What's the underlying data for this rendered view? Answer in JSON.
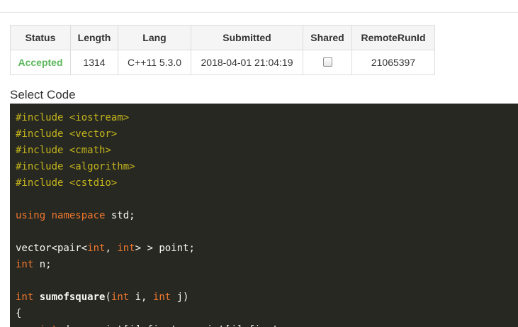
{
  "colors": {
    "accepted": "#5cb85c",
    "code_background": "#272822",
    "preprocessor": "#c4b41b",
    "keyword": "#f0782e",
    "code_text": "#f8f8f2"
  },
  "table": {
    "headers": {
      "status": "Status",
      "length": "Length",
      "lang": "Lang",
      "submitted": "Submitted",
      "shared": "Shared",
      "remote_run_id": "RemoteRunId"
    },
    "row": {
      "status": "Accepted",
      "length": "1314",
      "lang": "C++11 5.3.0",
      "submitted": "2018-04-01 21:04:19",
      "shared_checked": false,
      "remote_run_id": "21065397"
    }
  },
  "select_code_label": "Select Code",
  "code_lines": [
    [
      {
        "t": "#include <iostream>",
        "k": "meta"
      }
    ],
    [
      {
        "t": "#include <vector>",
        "k": "meta"
      }
    ],
    [
      {
        "t": "#include <cmath>",
        "k": "meta"
      }
    ],
    [
      {
        "t": "#include <algorithm>",
        "k": "meta"
      }
    ],
    [
      {
        "t": "#include <cstdio>",
        "k": "meta"
      }
    ],
    [],
    [
      {
        "t": "using",
        "k": "keyword"
      },
      {
        "t": " ",
        "k": "plain"
      },
      {
        "t": "namespace",
        "k": "keyword"
      },
      {
        "t": " std;",
        "k": "plain"
      }
    ],
    [],
    [
      {
        "t": "vector<pair<",
        "k": "plain"
      },
      {
        "t": "int",
        "k": "type"
      },
      {
        "t": ", ",
        "k": "plain"
      },
      {
        "t": "int",
        "k": "type"
      },
      {
        "t": "> > point;",
        "k": "plain"
      }
    ],
    [
      {
        "t": "int",
        "k": "type"
      },
      {
        "t": " n;",
        "k": "plain"
      }
    ],
    [],
    [
      {
        "t": "int",
        "k": "type"
      },
      {
        "t": " ",
        "k": "plain"
      },
      {
        "t": "sumofsquare",
        "k": "func"
      },
      {
        "t": "(",
        "k": "plain"
      },
      {
        "t": "int",
        "k": "type"
      },
      {
        "t": " i, ",
        "k": "plain"
      },
      {
        "t": "int",
        "k": "type"
      },
      {
        "t": " j)",
        "k": "plain"
      }
    ],
    [
      {
        "t": "{",
        "k": "plain"
      }
    ],
    [
      {
        "t": "    ",
        "k": "plain"
      },
      {
        "t": "int",
        "k": "type"
      },
      {
        "t": " dx = point[i].first - point[j].first;",
        "k": "plain"
      }
    ]
  ]
}
